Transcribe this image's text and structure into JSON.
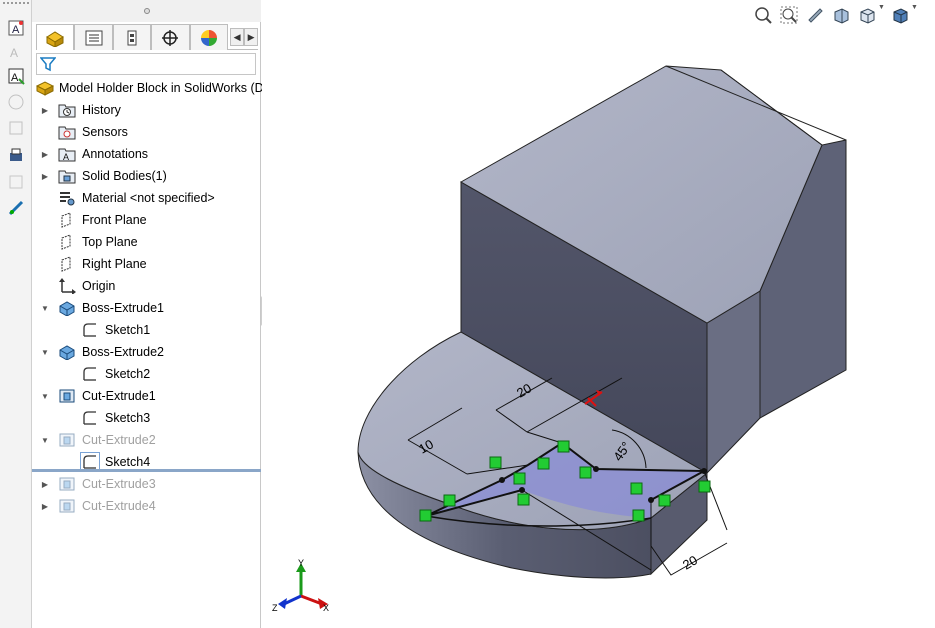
{
  "app": {
    "name": "SolidWorks"
  },
  "feature_tree": {
    "root_label": "Model Holder Block in SolidWorks  (De",
    "items": [
      {
        "label": "History",
        "icon": "history-folder-icon",
        "expandable": true,
        "indent": 0
      },
      {
        "label": "Sensors",
        "icon": "sensors-folder-icon",
        "expandable": false,
        "indent": 0
      },
      {
        "label": "Annotations",
        "icon": "annotations-folder-icon",
        "expandable": true,
        "indent": 0
      },
      {
        "label": "Solid Bodies(1)",
        "icon": "solid-bodies-folder-icon",
        "expandable": true,
        "indent": 0
      },
      {
        "label": "Material <not specified>",
        "icon": "material-icon",
        "expandable": false,
        "indent": 0
      },
      {
        "label": "Front Plane",
        "icon": "plane-icon",
        "expandable": false,
        "indent": 0
      },
      {
        "label": "Top Plane",
        "icon": "plane-icon",
        "expandable": false,
        "indent": 0
      },
      {
        "label": "Right Plane",
        "icon": "plane-icon",
        "expandable": false,
        "indent": 0
      },
      {
        "label": "Origin",
        "icon": "origin-icon",
        "expandable": false,
        "indent": 0
      },
      {
        "label": "Boss-Extrude1",
        "icon": "boss-extrude-icon",
        "expandable": true,
        "expanded": true,
        "indent": 0
      },
      {
        "label": "Sketch1",
        "icon": "sketch-icon",
        "expandable": false,
        "indent": 1
      },
      {
        "label": "Boss-Extrude2",
        "icon": "boss-extrude-icon",
        "expandable": true,
        "expanded": true,
        "indent": 0
      },
      {
        "label": "Sketch2",
        "icon": "sketch-icon",
        "expandable": false,
        "indent": 1
      },
      {
        "label": "Cut-Extrude1",
        "icon": "cut-extrude-icon",
        "expandable": true,
        "expanded": true,
        "indent": 0
      },
      {
        "label": "Sketch3",
        "icon": "sketch-icon",
        "expandable": false,
        "indent": 1
      },
      {
        "label": "Cut-Extrude2",
        "icon": "cut-extrude-icon",
        "expandable": true,
        "expanded": true,
        "indent": 0,
        "suppressed": true
      },
      {
        "label": "Sketch4",
        "icon": "sketch-icon",
        "expandable": false,
        "indent": 1,
        "editing": true
      },
      {
        "label": "Cut-Extrude3",
        "icon": "cut-extrude-icon",
        "expandable": true,
        "indent": 0,
        "suppressed": true
      },
      {
        "label": "Cut-Extrude4",
        "icon": "cut-extrude-icon",
        "expandable": true,
        "indent": 0,
        "suppressed": true
      }
    ]
  },
  "fm_tabs": [
    {
      "name": "featuremanager-tab",
      "icon": "part-icon",
      "active": true
    },
    {
      "name": "propertymanager-tab",
      "icon": "property-list-icon"
    },
    {
      "name": "configurationmanager-tab",
      "icon": "configuration-icon"
    },
    {
      "name": "dimxpert-tab",
      "icon": "crosshair-icon"
    },
    {
      "name": "display-manager-tab",
      "icon": "color-wheel-icon"
    }
  ],
  "sketch_dimensions": {
    "d1": "20",
    "d2": "10",
    "d3": "45°",
    "d4": "20"
  },
  "triad": {
    "x": "X",
    "y": "Y",
    "z": "Z"
  },
  "colors": {
    "model_top": "#a4a9bd",
    "model_front": "#4f5265",
    "model_side": "#6c7085",
    "sketch_fill": "#8a8cd6",
    "relation_green": "#22cc33",
    "accent_red": "#dd1111"
  }
}
